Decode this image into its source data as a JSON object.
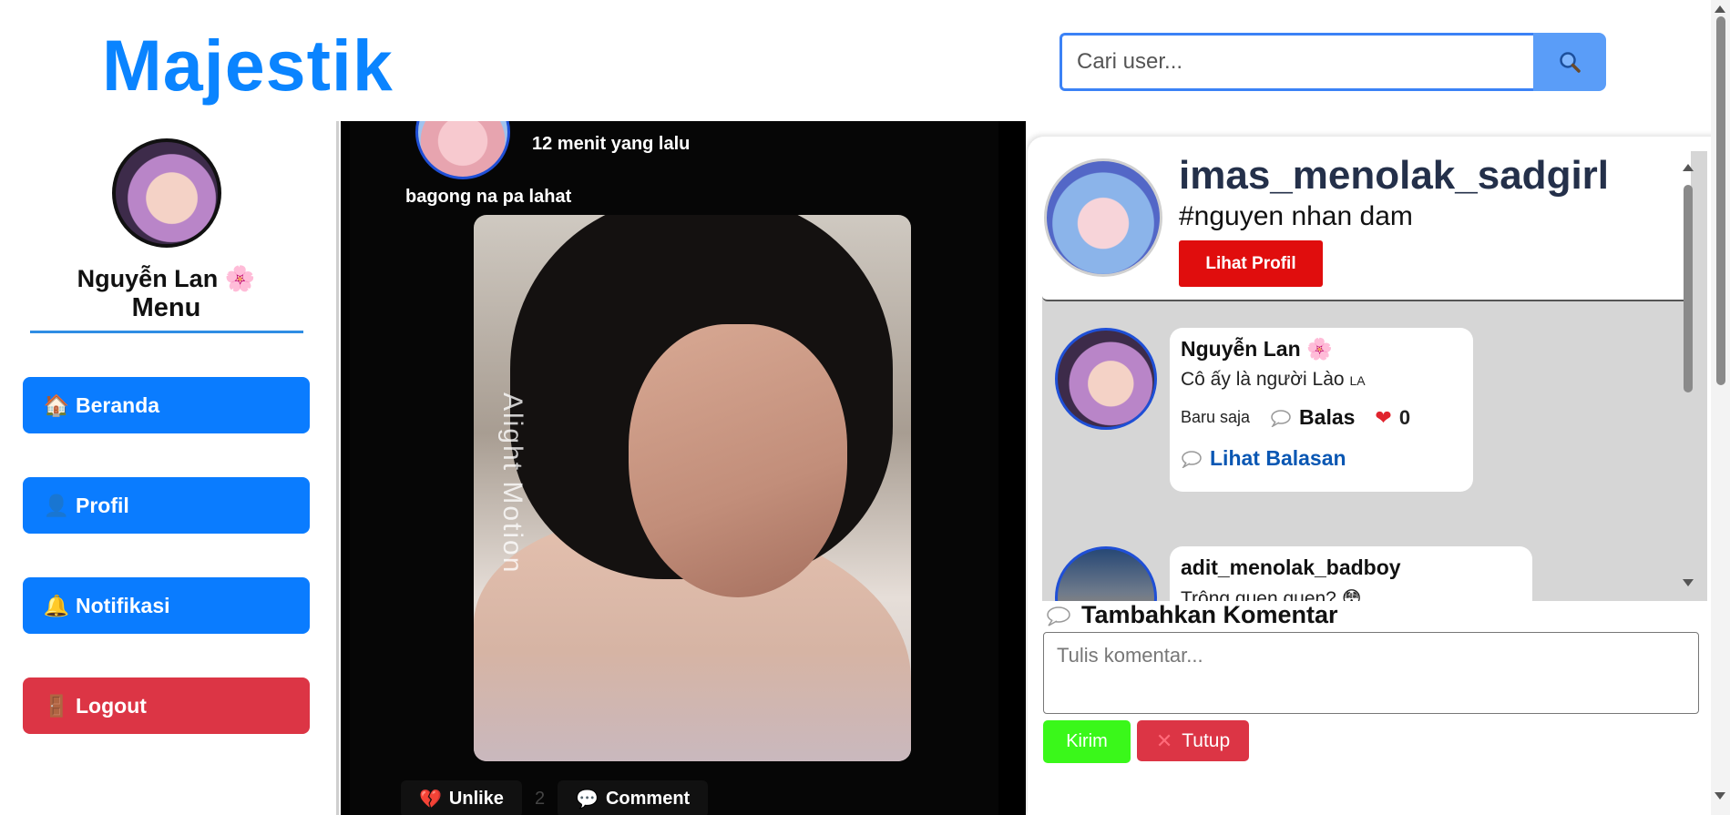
{
  "header": {
    "logo": "Majestik",
    "search": {
      "placeholder": "Cari user...",
      "icon": "search-icon"
    }
  },
  "sidebar": {
    "user_name": "Nguyễn Lan 🌸",
    "menu_title": "Menu",
    "items": [
      {
        "label": "Beranda",
        "icon": "home-icon",
        "emoji": "🏠",
        "color": "#0a7cff"
      },
      {
        "label": "Profil",
        "icon": "user-icon",
        "emoji": "👤",
        "color": "#0a7cff"
      },
      {
        "label": "Notifikasi",
        "icon": "bell-icon",
        "emoji": "🔔",
        "color": "#0a7cff"
      },
      {
        "label": "Logout",
        "icon": "door-icon",
        "emoji": "🚪",
        "color": "#dc3545"
      }
    ]
  },
  "post": {
    "time": "12 menit yang lalu",
    "caption": "bagong na pa lahat",
    "watermark": "Alight Motion",
    "like_count": "2",
    "unlike_label": "Unlike",
    "comment_label": "Comment"
  },
  "panel": {
    "profile": {
      "username": "imas_menolak_sadgirl",
      "tag": "#nguyen nhan dam",
      "view_profile": "Lihat Profil"
    },
    "comments": [
      {
        "name": "Nguyễn Lan 🌸",
        "text": "Cô ấy là người Lào",
        "text_suffix": "LA",
        "time": "Baru saja",
        "reply_label": "Balas",
        "likes": "0",
        "view_replies": "Lihat Balasan"
      },
      {
        "name": "adit_menolak_badboy",
        "text": "Trông quen quen? 😳"
      }
    ],
    "add_comment_title": "Tambahkan Komentar",
    "comment_placeholder": "Tulis komentar...",
    "send_label": "Kirim",
    "close_label": "Tutup"
  },
  "colors": {
    "brand": "#0a84ff",
    "nav_blue": "#0a7cff",
    "logout_red": "#dc3545",
    "profile_btn_red": "#e00d0d",
    "send_green": "#3af81a",
    "link_blue": "#0a57b3"
  }
}
